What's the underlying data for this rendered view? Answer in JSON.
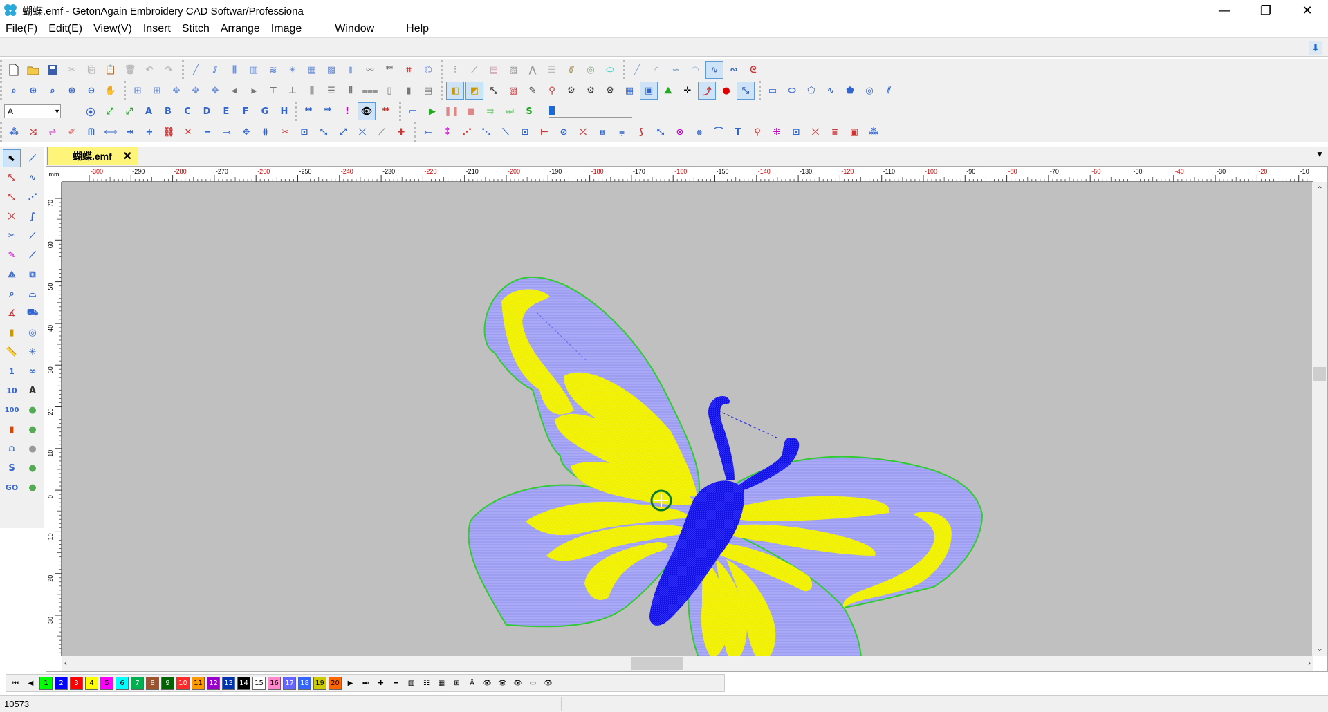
{
  "window": {
    "title": "蝴蝶.emf - GetonAgain Embroidery CAD Softwar/Professiona",
    "minimize": "—",
    "maximize": "❐",
    "close": "✕"
  },
  "menu": [
    {
      "label": "File(F)"
    },
    {
      "label": "Edit(E)"
    },
    {
      "label": "View(V)"
    },
    {
      "label": "Insert"
    },
    {
      "label": "Stitch"
    },
    {
      "label": "Arrange"
    },
    {
      "label": "Image"
    },
    {
      "label": "Window"
    },
    {
      "label": "Help"
    }
  ],
  "toolbar3": {
    "font_combo": "A",
    "letters": [
      "A",
      "B",
      "C",
      "D",
      "E",
      "F",
      "G",
      "H"
    ],
    "S_label": "S"
  },
  "left_tools": {
    "num1": "1",
    "num10": "10",
    "num100": "100",
    "S": "S",
    "GO": "GO"
  },
  "tab": {
    "label": "蝴蝶.emf",
    "close": "✕"
  },
  "ruler": {
    "unit": "mm",
    "x_ticks": [
      "-300",
      "-290",
      "-280",
      "-270",
      "-260",
      "-250",
      "-240",
      "-230",
      "-220",
      "-210",
      "-200",
      "-190",
      "-180",
      "-170",
      "-160",
      "-150",
      "-140",
      "-130",
      "-120",
      "-110",
      "-100",
      "-90",
      "-80",
      "-70",
      "-60",
      "-50",
      "-40",
      "-30",
      "-20",
      "-10"
    ],
    "y_ticks": [
      "70",
      "60",
      "50",
      "40",
      "30",
      "20",
      "10",
      "0",
      "10",
      "20",
      "30"
    ]
  },
  "palette": {
    "colors": [
      {
        "n": "1",
        "c": "#00ff00"
      },
      {
        "n": "2",
        "c": "#0000ff"
      },
      {
        "n": "3",
        "c": "#ff0000"
      },
      {
        "n": "4",
        "c": "#ffff00"
      },
      {
        "n": "5",
        "c": "#ff00ff"
      },
      {
        "n": "6",
        "c": "#00ffff"
      },
      {
        "n": "7",
        "c": "#00b050"
      },
      {
        "n": "8",
        "c": "#a0522d"
      },
      {
        "n": "9",
        "c": "#006400"
      },
      {
        "n": "10",
        "c": "#ff2a2a"
      },
      {
        "n": "11",
        "c": "#ff9900"
      },
      {
        "n": "12",
        "c": "#9900cc"
      },
      {
        "n": "13",
        "c": "#0033aa"
      },
      {
        "n": "14",
        "c": "#000000"
      },
      {
        "n": "15",
        "c": "#ffffff"
      },
      {
        "n": "16",
        "c": "#ff88cc"
      },
      {
        "n": "17",
        "c": "#6666ff"
      },
      {
        "n": "18",
        "c": "#3366ff"
      },
      {
        "n": "19",
        "c": "#cccc00"
      },
      {
        "n": "20",
        "c": "#ff6600"
      }
    ]
  },
  "status": {
    "count": "10573"
  }
}
